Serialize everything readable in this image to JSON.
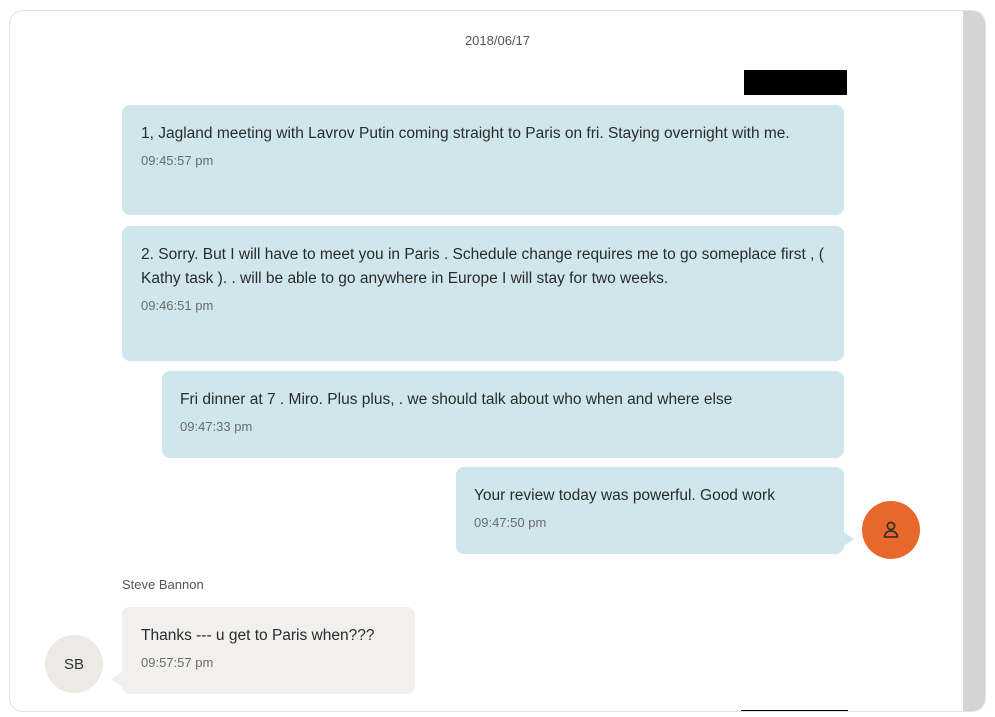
{
  "conversation": {
    "date": "2018/06/17",
    "messages": [
      {
        "text": "1,  Jagland meeting with Lavrov Putin coming straight to Paris on fri.  Staying overnight with me.",
        "time": "09:45:57 pm"
      },
      {
        "text": "2. Sorry. But I will have to meet you in Paris .  Schedule change requires me to go someplace first , ( Kathy task ). . will be able to go anywhere in Europe I will stay for two weeks.",
        "time": "09:46:51 pm"
      },
      {
        "text": "Fri dinner at 7 .  Miro. Plus plus, .   we should talk about who when and where else",
        "time": "09:47:33 pm"
      },
      {
        "text": "Your review today was powerful.  Good work",
        "time": "09:47:50 pm"
      }
    ],
    "incoming": {
      "sender_name": "Steve Bannon",
      "avatar_initials": "SB",
      "text": "Thanks --- u get to Paris when???",
      "time": "09:57:57 pm"
    },
    "user_avatar_icon": "person-icon",
    "colors": {
      "outgoing_bubble": "#cfe6ec",
      "incoming_bubble": "#f1f0ee",
      "user_avatar": "#e8672a",
      "sender_avatar": "#ecebe3",
      "redaction": "#000000"
    }
  }
}
